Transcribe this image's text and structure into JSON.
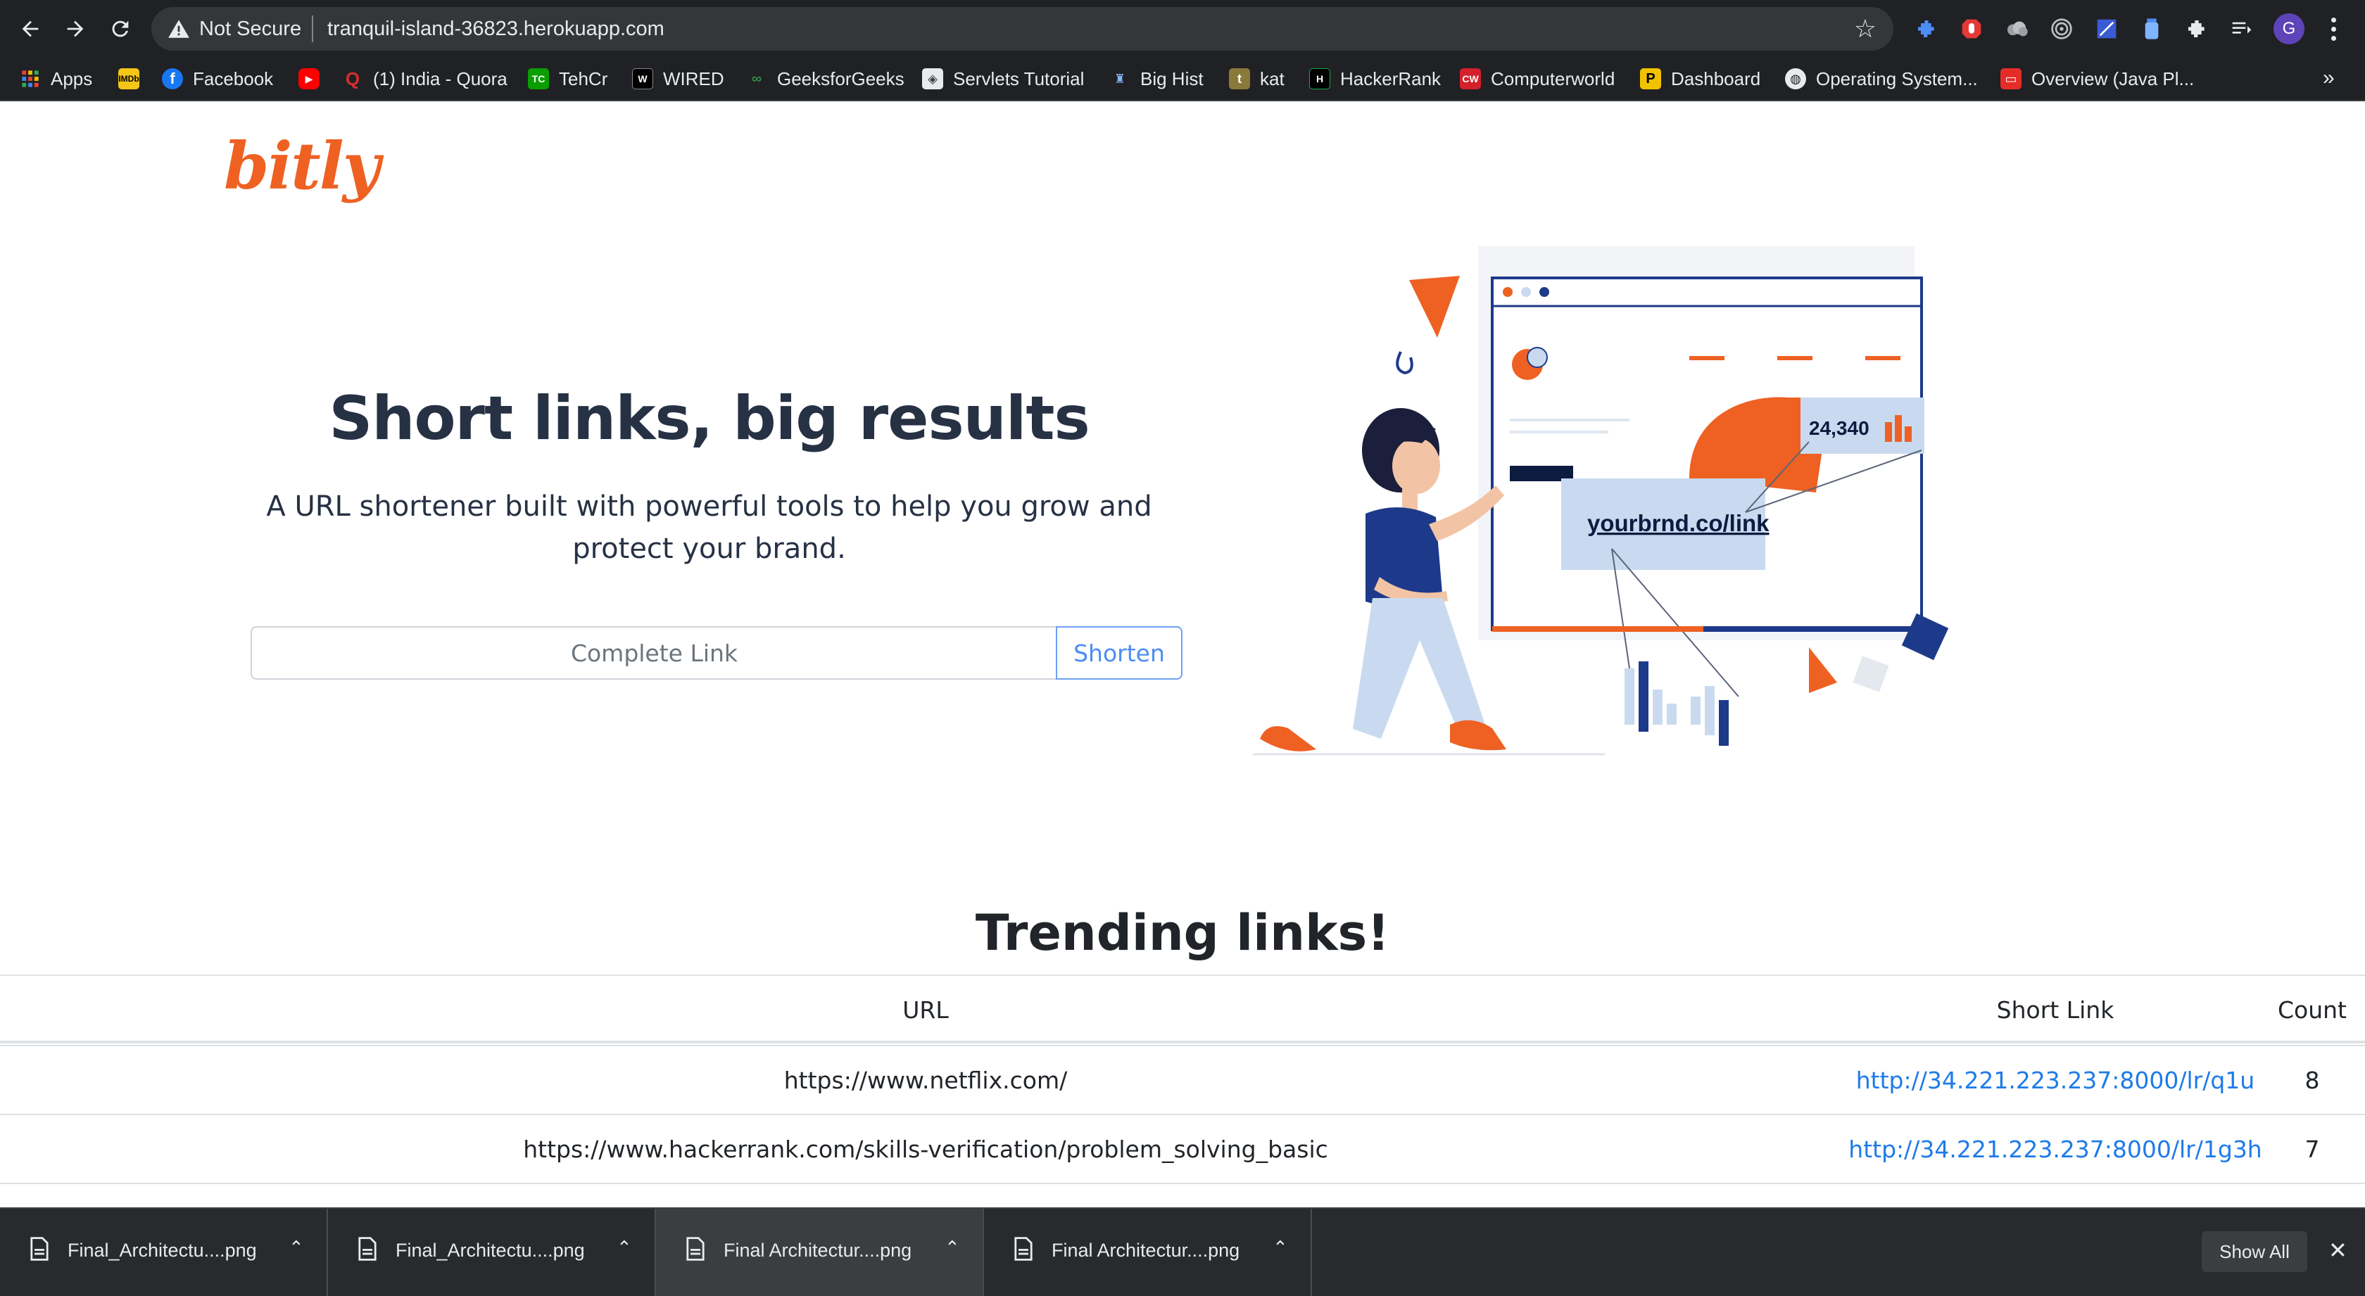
{
  "browser": {
    "security_label": "Not Secure",
    "url": "tranquil-island-36823.herokuapp.com",
    "profile_initial": "G",
    "bookmarks": [
      {
        "label": "Apps",
        "icon": "apps-grid-icon",
        "color": "#4285f4"
      },
      {
        "label": "",
        "icon": "imdb-icon",
        "color": "#f5c518"
      },
      {
        "label": "Facebook",
        "icon": "facebook-icon",
        "color": "#1877f2"
      },
      {
        "label": "",
        "icon": "youtube-icon",
        "color": "#ff0000"
      },
      {
        "label": "(1) India - Quora",
        "icon": "quora-icon",
        "color": "#b92b27"
      },
      {
        "label": "TehCr",
        "icon": "techcrunch-icon",
        "color": "#0a9e01"
      },
      {
        "label": "WIRED",
        "icon": "wired-icon",
        "color": "#000000"
      },
      {
        "label": "GeeksforGeeks",
        "icon": "geeksforgeeks-icon",
        "color": "#2f8d46"
      },
      {
        "label": "Servlets Tutorial",
        "icon": "servlets-icon",
        "color": "#888888"
      },
      {
        "label": "Big Hist",
        "icon": "bighist-icon",
        "color": "#5b7ec7"
      },
      {
        "label": "kat",
        "icon": "kat-icon",
        "color": "#8a7a3a"
      },
      {
        "label": "HackerRank",
        "icon": "hackerrank-icon",
        "color": "#1ba94c"
      },
      {
        "label": "Computerworld",
        "icon": "computerworld-icon",
        "color": "#d3202a"
      },
      {
        "label": "Dashboard",
        "icon": "dashboard-icon",
        "color": "#f2c200"
      },
      {
        "label": "Operating System...",
        "icon": "globe-icon",
        "color": "#e8eaed"
      },
      {
        "label": "Overview (Java Pl...",
        "icon": "oracle-icon",
        "color": "#e52d27"
      }
    ]
  },
  "page": {
    "logo": "bitly",
    "hero_title": "Short links, big results",
    "hero_subtitle_line1": "A URL shortener built with powerful tools to help you grow and",
    "hero_subtitle_line2": "protect your brand.",
    "input_placeholder": "Complete Link",
    "shorten_label": "Shorten",
    "illustration": {
      "stat": "24,340",
      "link": "yourbrnd.co/link"
    },
    "trending_title": "Trending links!",
    "table": {
      "headers": {
        "url": "URL",
        "short": "Short Link",
        "count": "Count"
      },
      "rows": [
        {
          "url": "https://www.netflix.com/",
          "short": "http://34.221.223.237:8000/lr/q1u",
          "count": "8"
        },
        {
          "url": "https://www.hackerrank.com/skills-verification/problem_solving_basic",
          "short": "http://34.221.223.237:8000/lr/1g3h",
          "count": "7"
        }
      ]
    }
  },
  "downloads": {
    "items": [
      {
        "name": "Final_Architectu....png"
      },
      {
        "name": "Final_Architectu....png"
      },
      {
        "name": "Final Architectur....png"
      },
      {
        "name": "Final Architectur....png"
      }
    ],
    "show_all": "Show All"
  },
  "colors": {
    "brand": "#ee6123",
    "link": "#1e7be9",
    "navy": "#1d3a8a",
    "light_blue": "#c9daf0"
  }
}
